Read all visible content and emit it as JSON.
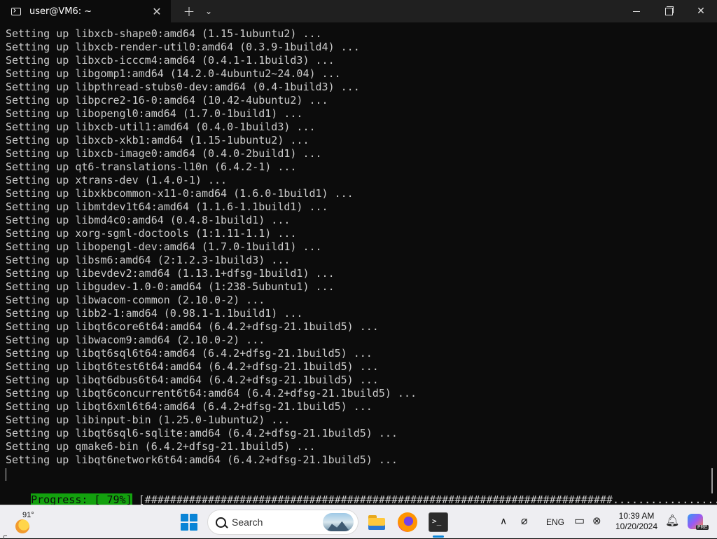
{
  "window": {
    "tab_title": "user@VM6: ~",
    "tab_close": "✕",
    "new_tab": "+",
    "dropdown": "⌄",
    "close": "✕"
  },
  "terminal": {
    "lines": [
      "Setting up libxcb-shape0:amd64 (1.15-1ubuntu2) ...",
      "Setting up libxcb-render-util0:amd64 (0.3.9-1build4) ...",
      "Setting up libxcb-icccm4:amd64 (0.4.1-1.1build3) ...",
      "Setting up libgomp1:amd64 (14.2.0-4ubuntu2~24.04) ...",
      "Setting up libpthread-stubs0-dev:amd64 (0.4-1build3) ...",
      "Setting up libpcre2-16-0:amd64 (10.42-4ubuntu2) ...",
      "Setting up libopengl0:amd64 (1.7.0-1build1) ...",
      "Setting up libxcb-util1:amd64 (0.4.0-1build3) ...",
      "Setting up libxcb-xkb1:amd64 (1.15-1ubuntu2) ...",
      "Setting up libxcb-image0:amd64 (0.4.0-2build1) ...",
      "Setting up qt6-translations-l10n (6.4.2-1) ...",
      "Setting up xtrans-dev (1.4.0-1) ...",
      "Setting up libxkbcommon-x11-0:amd64 (1.6.0-1build1) ...",
      "Setting up libmtdev1t64:amd64 (1.1.6-1.1build1) ...",
      "Setting up libmd4c0:amd64 (0.4.8-1build1) ...",
      "Setting up xorg-sgml-doctools (1:1.11-1.1) ...",
      "Setting up libopengl-dev:amd64 (1.7.0-1build1) ...",
      "Setting up libsm6:amd64 (2:1.2.3-1build3) ...",
      "Setting up libevdev2:amd64 (1.13.1+dfsg-1build1) ...",
      "Setting up libgudev-1.0-0:amd64 (1:238-5ubuntu1) ...",
      "Setting up libwacom-common (2.10.0-2) ...",
      "Setting up libb2-1:amd64 (0.98.1-1.1build1) ...",
      "Setting up libqt6core6t64:amd64 (6.4.2+dfsg-21.1build5) ...",
      "Setting up libwacom9:amd64 (2.10.0-2) ...",
      "Setting up libqt6sql6t64:amd64 (6.4.2+dfsg-21.1build5) ...",
      "Setting up libqt6test6t64:amd64 (6.4.2+dfsg-21.1build5) ...",
      "Setting up libqt6dbus6t64:amd64 (6.4.2+dfsg-21.1build5) ...",
      "Setting up libqt6concurrent6t64:amd64 (6.4.2+dfsg-21.1build5) ...",
      "Setting up libqt6xml6t64:amd64 (6.4.2+dfsg-21.1build5) ...",
      "Setting up libinput-bin (1.25.0-1ubuntu2) ...",
      "Setting up libqt6sql6-sqlite:amd64 (6.4.2+dfsg-21.1build5) ...",
      "Setting up qmake6-bin (6.4.2+dfsg-21.1build5) ...",
      "Setting up libqt6network6t64:amd64 (6.4.2+dfsg-21.1build5) ..."
    ],
    "progress_label": "Progress: [ 79%]",
    "progress_bar": " [##########################################################################.................] ",
    "progress_percent": 79,
    "progress_color": "#13a10e"
  },
  "taskbar": {
    "weather_temp": "91°",
    "search_placeholder": "Search",
    "terminal_glyph": ">_",
    "tray_chevron": "∧",
    "tray_network": "⌀",
    "language": "ENG",
    "tray_display": "▭",
    "tray_volume": "⊗",
    "time": "10:39 AM",
    "date": "10/20/2024",
    "bell": "🔔︎",
    "copilot_tag": "PRE"
  },
  "colors": {
    "terminal_bg": "#0c0c0c",
    "terminal_fg": "#cccccc",
    "titlebar_bg": "#202020",
    "taskbar_bg": "#eeeef2",
    "accent": "#0a84d6"
  }
}
